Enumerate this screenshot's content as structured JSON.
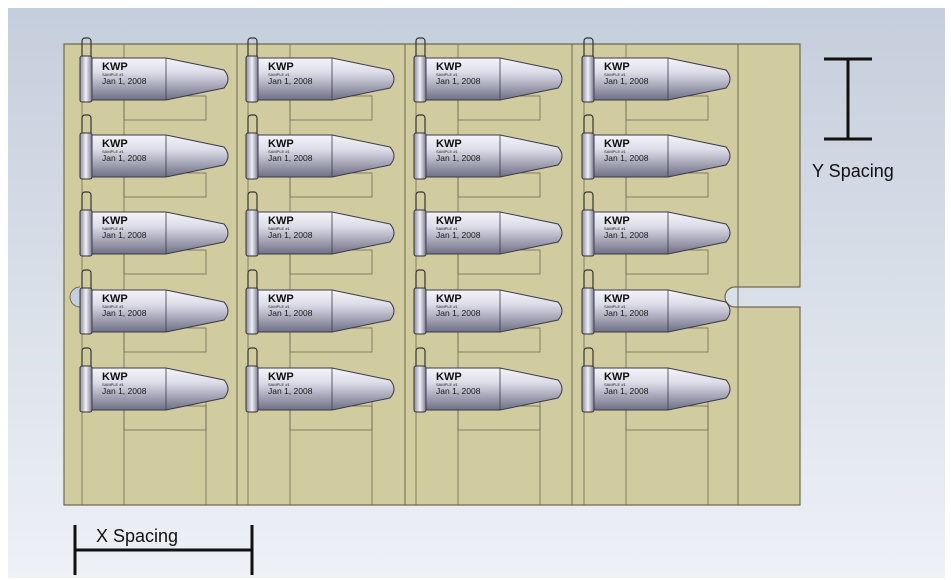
{
  "colors": {
    "background_gradient_top": "#c5cedc",
    "background_gradient_bottom": "#eef1f6",
    "plate_fill": "#d1cba0",
    "plate_edge": "#6e6a50",
    "tube_body_light": "#f4f4fa",
    "tube_body_dark": "#6f6f86",
    "dimension_line": "#111111"
  },
  "diagram": {
    "columns": 4,
    "rows": 5,
    "tube_label": {
      "title": "KWP",
      "sample": "SAMPLE #1",
      "date": "Jan 1, 2008"
    }
  },
  "dimensions": {
    "x_spacing_label": "X Spacing",
    "y_spacing_label": "Y Spacing"
  }
}
